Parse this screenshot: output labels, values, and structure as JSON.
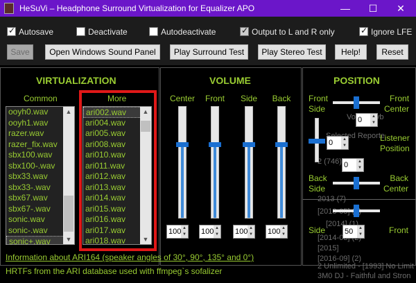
{
  "window": {
    "title": "HeSuVi – Headphone Surround Virtualization for Equalizer APO",
    "minimize": "—",
    "maximize": "☐",
    "close": "✕"
  },
  "options": [
    {
      "label": "Autosave",
      "checked": true
    },
    {
      "label": "Deactivate",
      "checked": false
    },
    {
      "label": "Autodeactivate",
      "checked": false
    },
    {
      "label": "Output to L and R only",
      "checked": true
    },
    {
      "label": "Ignore LFE",
      "checked": true
    }
  ],
  "buttons": {
    "save": "Save",
    "sound_panel": "Open Windows Sound Panel",
    "surround_test": "Play Surround Test",
    "stereo_test": "Play Stereo Test",
    "help": "Help!",
    "reset": "Reset"
  },
  "virtualization": {
    "heading": "VIRTUALIZATION",
    "common_label": "Common",
    "more_label": "More",
    "common_items": [
      "ooyh0.wav",
      "ooyh1.wav",
      "razer.wav",
      "razer_fix.wav",
      "sbx100.wav",
      "sbx100-.wav",
      "sbx33.wav",
      "sbx33-.wav",
      "sbx67.wav",
      "sbx67-.wav",
      "sonic.wav",
      "sonic-.wav",
      "sonic+.wav"
    ],
    "common_selected": "sonic+.wav",
    "more_items": [
      "ari002.wav",
      "ari004.wav",
      "ari005.wav",
      "ari008.wav",
      "ari010.wav",
      "ari011.wav",
      "ari012.wav",
      "ari013.wav",
      "ari014.wav",
      "ari015.wav",
      "ari016.wav",
      "ari017.wav",
      "ari018.wav"
    ],
    "more_selected": "ari002.wav"
  },
  "volume": {
    "heading": "VOLUME",
    "channels": [
      {
        "label": "Center",
        "value": "100"
      },
      {
        "label": "Front",
        "value": "100"
      },
      {
        "label": "Side",
        "value": "100"
      },
      {
        "label": "Back",
        "value": "100"
      }
    ]
  },
  "position": {
    "heading": "POSITION",
    "front_side": "Front\nSide",
    "front_center": "Front\nCenter",
    "listener": "Listener\nPosition",
    "back_side": "Back\nSide",
    "back_center": "Back\nCenter",
    "side": "Side",
    "front": "Front",
    "front_side_angle": "0",
    "listener_angle": "0",
    "back_side_angle": "0",
    "side_front_angle": "50"
  },
  "footer": {
    "link": "Information about ARI164 (speaker angles of 30°, 90°, 135° and 0°)",
    "info": "HRTFs from the ARI database used with ffmpeg`s sofalizer"
  },
  "background_ghost": [
    "Playb",
    "Volume",
    "Selected Reporte",
    "2 (746)",
    "2013 (7)",
    "[2013-05] (1)",
    "[2014] (1)",
    "[2014-03] (2)",
    "[2015]",
    "[2016-09] (2)",
    "2 Unlimited - [1993] No Limit",
    "3M0 DJ - Faithful and Stron"
  ],
  "colors": {
    "accent": "#9acd32",
    "titlebar": "#6b16c9",
    "highlight": "#e01818",
    "slider": "#1a6fd1"
  }
}
